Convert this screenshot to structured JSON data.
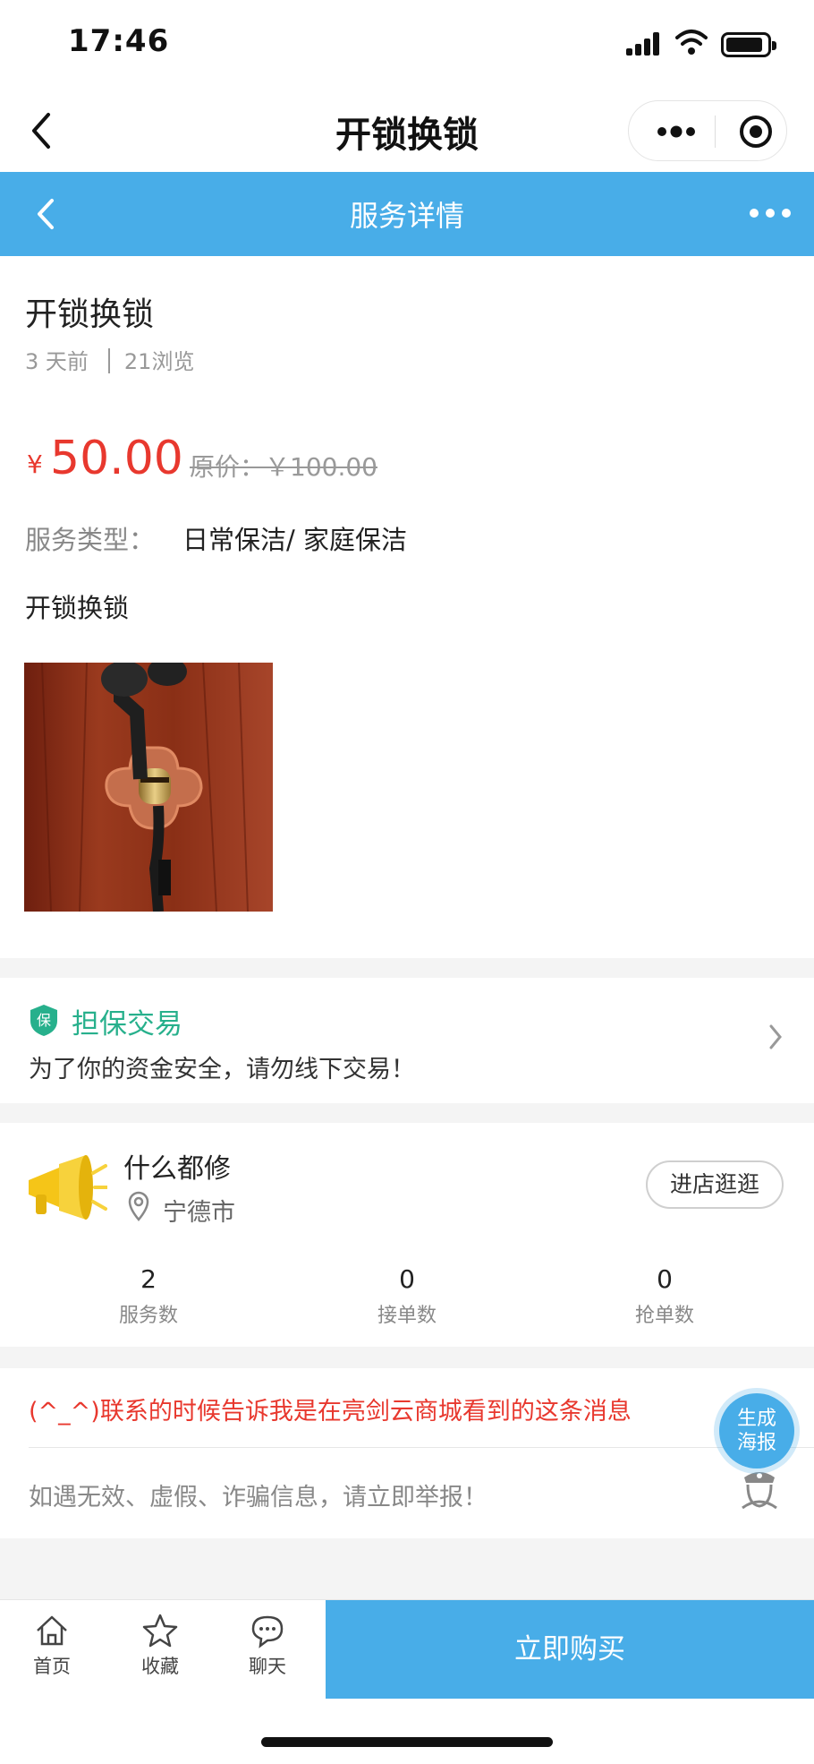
{
  "status_bar": {
    "time": "17:46"
  },
  "mini_program_nav": {
    "title": "开锁换锁"
  },
  "header": {
    "title": "服务详情"
  },
  "service": {
    "title": "开锁换锁",
    "posted": "3 天前",
    "views": "21浏览",
    "price_symbol": "¥",
    "price": "50.00",
    "original_price": "原价：￥100.00",
    "type_label": "服务类型：",
    "type_value": "日常保洁/ 家庭保洁",
    "description": "开锁换锁"
  },
  "guarantee": {
    "badge": "保",
    "title": "担保交易",
    "subtitle": "为了你的资金安全，请勿线下交易！"
  },
  "shop": {
    "name": "什么都修",
    "city": "宁德市",
    "visit_label": "进店逛逛",
    "stats": [
      {
        "value": "2",
        "label": "服务数"
      },
      {
        "value": "0",
        "label": "接单数"
      },
      {
        "value": "0",
        "label": "抢单数"
      }
    ]
  },
  "notice": {
    "contact_tip": "(^_^)联系的时候告诉我是在亮剑云商城看到的这条消息",
    "report_tip": "如遇无效、虚假、诈骗信息，请立即举报！"
  },
  "poster_button": {
    "line1": "生成",
    "line2": "海报"
  },
  "bottom_bar": {
    "tabs": [
      {
        "label": "首页",
        "icon": "home-icon"
      },
      {
        "label": "收藏",
        "icon": "star-icon"
      },
      {
        "label": "聊天",
        "icon": "chat-icon"
      }
    ],
    "buy_label": "立即购买"
  },
  "colors": {
    "accent": "#48ade8",
    "price": "#e8382e",
    "guarantee": "#27b08c"
  }
}
